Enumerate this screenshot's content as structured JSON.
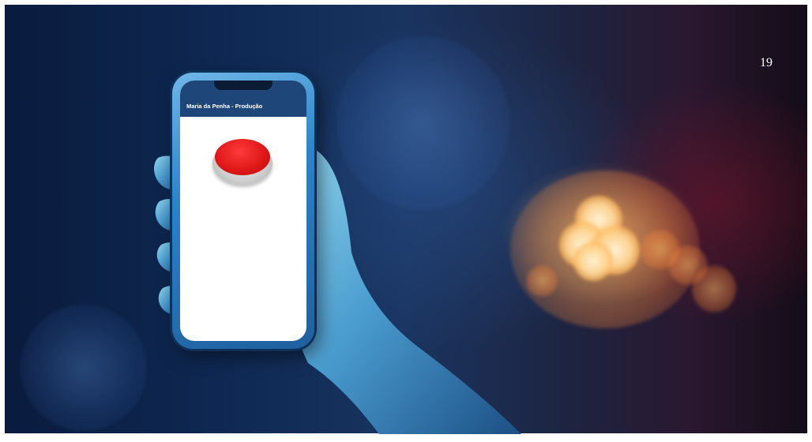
{
  "page": {
    "number": "19"
  },
  "phone": {
    "app_title": "Maria da Penha - Produção",
    "header_color": "#1f4678",
    "button_color": "#e01818"
  },
  "icons": {
    "panic": "red-panic-button"
  }
}
